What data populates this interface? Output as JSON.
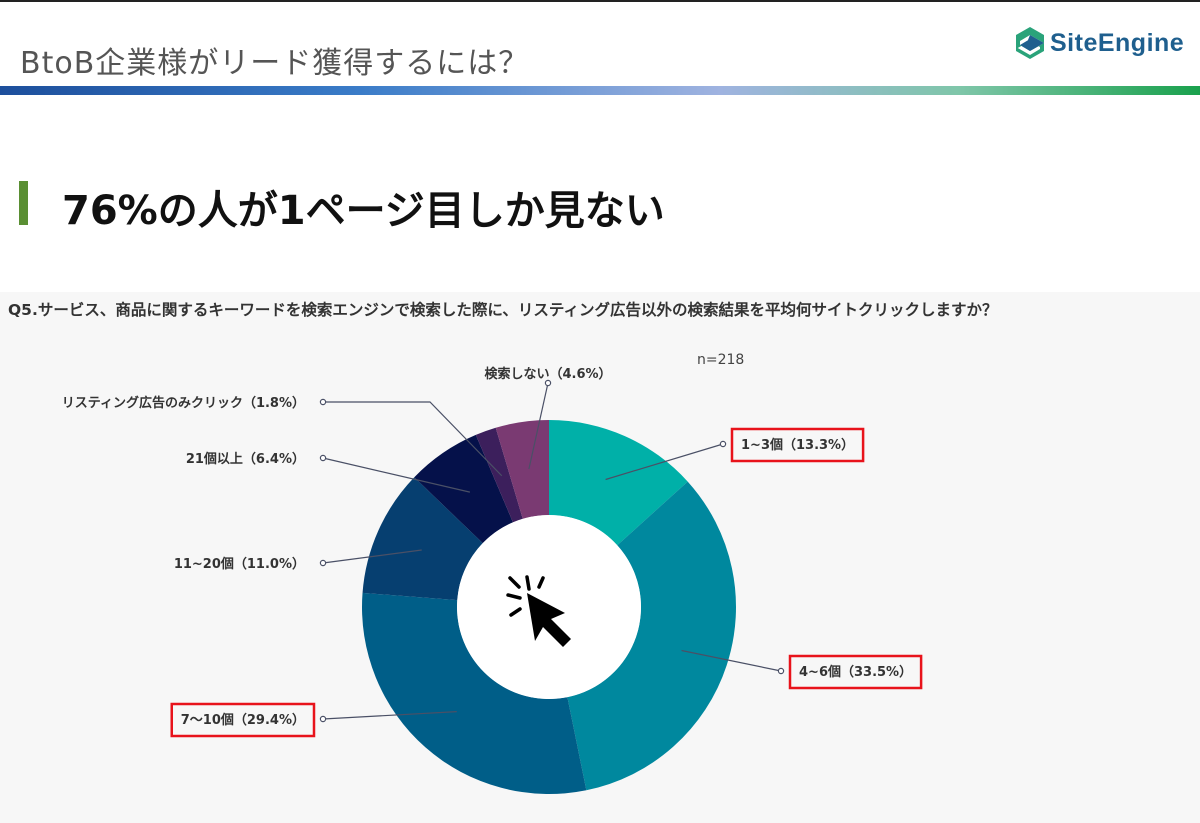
{
  "header": {
    "title": "BtoB企業様がリード獲得するには？",
    "logo_text": "SiteEngine"
  },
  "heading": "76%の人が1ページ目しか見ない",
  "colors": {
    "accent_bar": "#5a8f33",
    "highlight_box": "#e8131b"
  },
  "chart_data": {
    "type": "pie",
    "title": "Q5.サービス、商品に関するキーワードを検索エンジンで検索した際に、リスティング広告以外の検索結果を平均何サイトクリックしますか？",
    "note": "n=218",
    "center_icon": "cursor-click-icon",
    "slices": [
      {
        "label": "1~3個（13.3%）",
        "value": 13.3,
        "color": "#00b0a8",
        "highlighted": true
      },
      {
        "label": "4~6個（33.5%）",
        "value": 33.5,
        "color": "#00889e",
        "highlighted": true
      },
      {
        "label": "7〜10個（29.4%）",
        "value": 29.4,
        "color": "#005e88",
        "highlighted": true
      },
      {
        "label": "11~20個（11.0%）",
        "value": 11.0,
        "color": "#063f70",
        "highlighted": false
      },
      {
        "label": "21個以上（6.4%）",
        "value": 6.4,
        "color": "#05114a",
        "highlighted": false
      },
      {
        "label": "リスティング広告のみクリック（1.8%）",
        "value": 1.8,
        "color": "#3c1f5c",
        "highlighted": false
      },
      {
        "label": "検索しない（4.6%）",
        "value": 4.6,
        "color": "#7a3a72",
        "highlighted": false
      }
    ]
  }
}
